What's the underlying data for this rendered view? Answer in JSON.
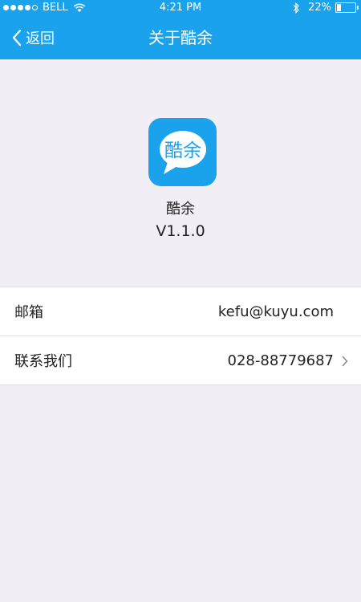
{
  "status_bar": {
    "carrier": "BELL",
    "time": "4:21 PM",
    "battery_percent": "22%",
    "battery_level": 0.22,
    "signal_bars": 4,
    "signal_max": 5
  },
  "nav": {
    "back_label": "返回",
    "title": "关于酷余"
  },
  "app": {
    "logo_text": "酷余",
    "name": "酷余",
    "version": "V1.1.0"
  },
  "info": [
    {
      "label": "邮箱",
      "value": "kefu@kuyu.com",
      "chevron": false
    },
    {
      "label": "联系我们",
      "value": "028-88779687",
      "chevron": true
    }
  ],
  "colors": {
    "accent": "#1aa3ec",
    "background": "#f2eef5",
    "row_background": "#ffffff"
  },
  "icons": [
    "wifi-icon",
    "bluetooth-icon",
    "battery-icon",
    "back-chevron-icon",
    "chevron-right-icon"
  ]
}
